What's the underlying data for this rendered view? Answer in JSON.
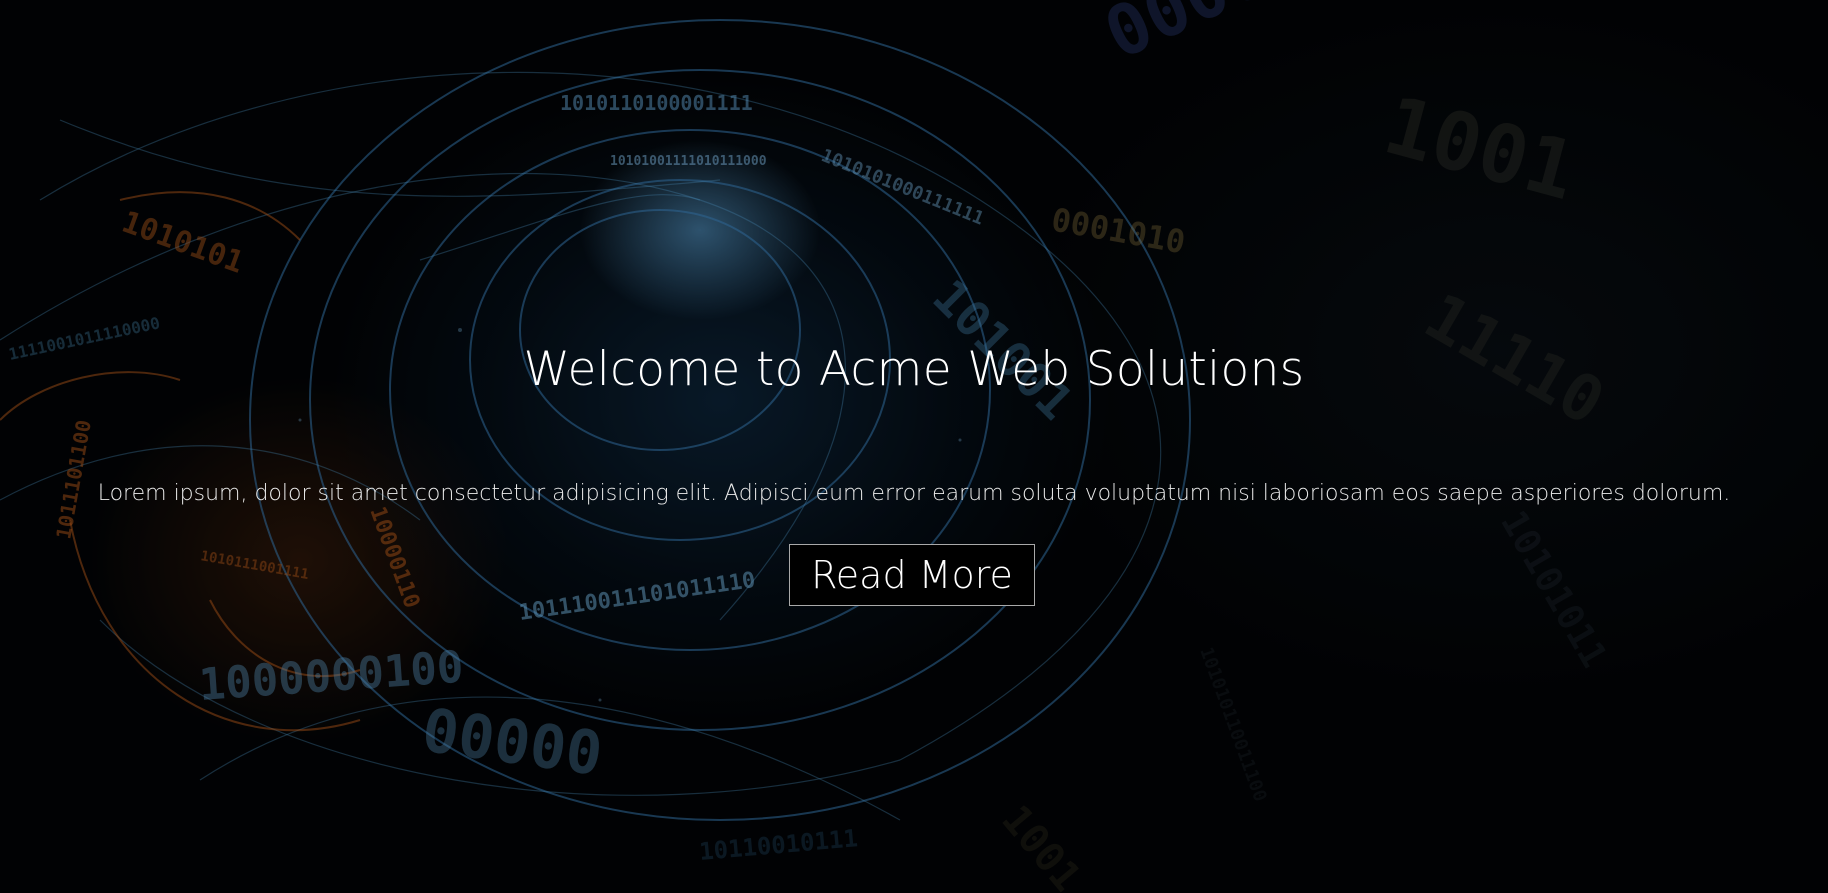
{
  "hero": {
    "title": "Welcome to Acme Web Solutions",
    "lead": "Lorem ipsum, dolor sit amet consectetur adipisicing elit. Adipisci eum error earum soluta voluptatum nisi laboriosam eos saepe asperiores dolorum.",
    "button_label": "Read More",
    "background_image": "abstract-binary-swirl-image"
  },
  "colors": {
    "background": "#020406",
    "text": "#ffffff",
    "accent_blue": "#4a9fd8",
    "accent_orange": "#d86a1e",
    "button_border": "#a9a9a9"
  }
}
